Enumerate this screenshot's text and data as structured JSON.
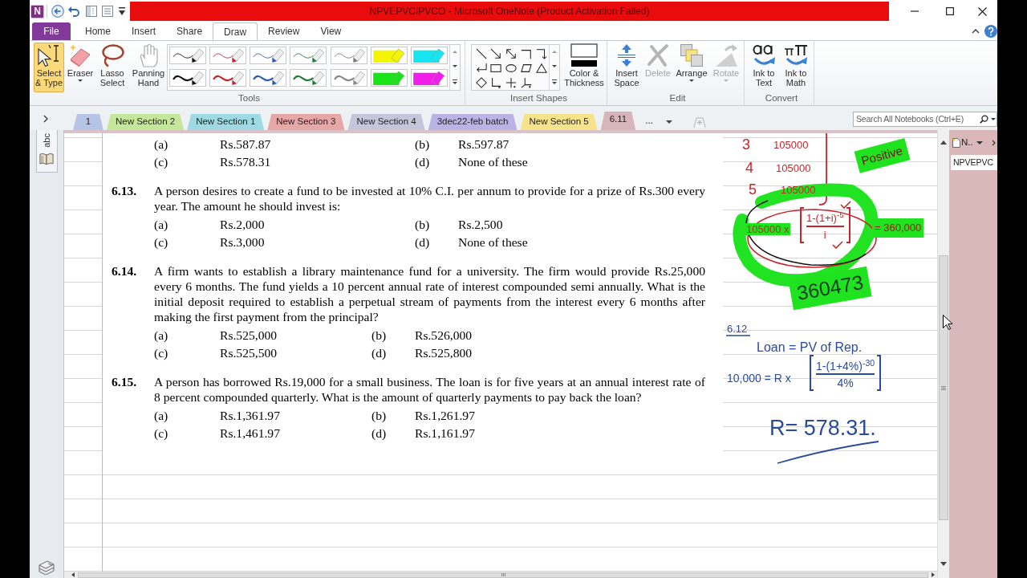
{
  "window": {
    "logo": "N",
    "title": "NPVEPVCIPVCO - Microsoft OneNote (Product Activation Failed)"
  },
  "ribbon": {
    "tabs": [
      {
        "label": "File",
        "kind": "file",
        "selected": false
      },
      {
        "label": "Home",
        "kind": "tab",
        "selected": false
      },
      {
        "label": "Insert",
        "kind": "tab",
        "selected": false
      },
      {
        "label": "Share",
        "kind": "tab",
        "selected": false
      },
      {
        "label": "Draw",
        "kind": "tab",
        "selected": true
      },
      {
        "label": "Review",
        "kind": "tab",
        "selected": false
      },
      {
        "label": "View",
        "kind": "tab",
        "selected": false
      }
    ],
    "groups": [
      {
        "label": "Tools",
        "buttons": [
          {
            "label": "Select & Type",
            "selected": true,
            "dropdown": false
          },
          {
            "label": "Eraser",
            "selected": false,
            "dropdown": true
          },
          {
            "label": "Lasso Select",
            "selected": false,
            "dropdown": false
          },
          {
            "label": "Panning Hand",
            "selected": false,
            "dropdown": false
          }
        ]
      },
      {
        "label": "Insert Shapes",
        "buttons": [
          {
            "label": "Color & Thickness"
          }
        ]
      },
      {
        "label": "Edit",
        "buttons": [
          {
            "label": "Insert Space",
            "disabled": false,
            "dropdown": false
          },
          {
            "label": "Delete",
            "disabled": true,
            "dropdown": false
          },
          {
            "label": "Arrange",
            "disabled": false,
            "dropdown": true
          },
          {
            "label": "Rotate",
            "disabled": true,
            "dropdown": true
          }
        ]
      },
      {
        "label": "Convert",
        "buttons": [
          {
            "label": "Ink to Text"
          },
          {
            "label": "Ink to Math"
          }
        ]
      }
    ]
  },
  "sections": {
    "tabs": [
      {
        "label": "1",
        "color": "#b6c5e6",
        "selected": false
      },
      {
        "label": "New Section 2",
        "color": "#c6e79b",
        "selected": false
      },
      {
        "label": "New Section 1",
        "color": "#9fd9e3",
        "selected": false
      },
      {
        "label": "New Section 3",
        "color": "#e7a7a6",
        "selected": false
      },
      {
        "label": "New Section 4",
        "color": "#c5c6d9",
        "selected": false
      },
      {
        "label": "3dec22-feb batch",
        "color": "#bbb3e6",
        "selected": false
      },
      {
        "label": "New Section 5",
        "color": "#f6e38c",
        "selected": false
      },
      {
        "label": "6.11",
        "color": "#d8b5b8",
        "selected": true
      }
    ],
    "overflow": "..."
  },
  "search": {
    "placeholder": "Search All Notebooks (Ctrl+E)"
  },
  "navigation": {
    "notebook": "abc"
  },
  "page": {
    "questions": [
      {
        "options": [
          {
            "letter": "(a)",
            "value": "Rs.587.87"
          },
          {
            "letter": "(b)",
            "value": "Rs.597.87"
          },
          {
            "letter": "(c)",
            "value": "Rs.578.31"
          },
          {
            "letter": "(d)",
            "value": "None of these"
          }
        ]
      },
      {
        "number": "6.13.",
        "text": "A person desires to create a fund to be invested at 10% C.I. per annum to provide for a prize of Rs.300 every year. The amount he should invest is:",
        "options": [
          {
            "letter": "(a)",
            "value": "Rs.2,000"
          },
          {
            "letter": "(b)",
            "value": "Rs.2,500"
          },
          {
            "letter": "(c)",
            "value": "Rs.3,000"
          },
          {
            "letter": "(d)",
            "value": "None of these"
          }
        ]
      },
      {
        "number": "6.14.",
        "text": "A firm wants to establish a library maintenance fund for a university. The firm would provide Rs.25,000 every 6 months. The fund yields a 10 percent annual rate of interest compounded semi annually. What is the initial deposit required to establish a perpetual stream of payments from the interest every 6 months after making the first payment from the principal?",
        "options": [
          {
            "letter": "(a)",
            "value": "Rs.525,000"
          },
          {
            "letter": "(b)",
            "value": "Rs.526,000"
          },
          {
            "letter": "(c)",
            "value": "Rs.525,500"
          },
          {
            "letter": "(d)",
            "value": "Rs.525,800"
          }
        ]
      },
      {
        "number": "6.15.",
        "text": "A person has borrowed Rs.19,000 for a small business. The loan is for five years at an annual interest rate of 8 percent compounded quarterly. What is the amount of quarterly payments to pay back the loan?",
        "options": [
          {
            "letter": "(a)",
            "value": "Rs.1,361.97"
          },
          {
            "letter": "(b)",
            "value": "Rs.1,261.97"
          },
          {
            "letter": "(c)",
            "value": "Rs.1,461.97"
          },
          {
            "letter": "(d)",
            "value": "Rs.1,161.97"
          }
        ]
      }
    ],
    "ink": {
      "rows": [
        {
          "index": "3",
          "amount": "105000"
        },
        {
          "index": "4",
          "amount": "105000"
        },
        {
          "index": "5",
          "amount": "105000"
        }
      ],
      "note": "Positive",
      "formula": {
        "lhs": "105000 x",
        "numerator": "1-(1+i)$^{-5}$",
        "denominator": "i",
        "rhs": "= 360,000"
      },
      "result": "360473",
      "solution": {
        "label": "6.12",
        "heading": "Loan = PV of Rep.",
        "lhs": "10,000 = R x",
        "numerator": "1-(1+4%)$^{-30}$",
        "denominator": "4%",
        "answer": "R= 578.31."
      }
    }
  },
  "pages_pane": {
    "new_page": "N..",
    "pages": [
      {
        "title": "NPVEPVC",
        "selected": true
      }
    ]
  }
}
